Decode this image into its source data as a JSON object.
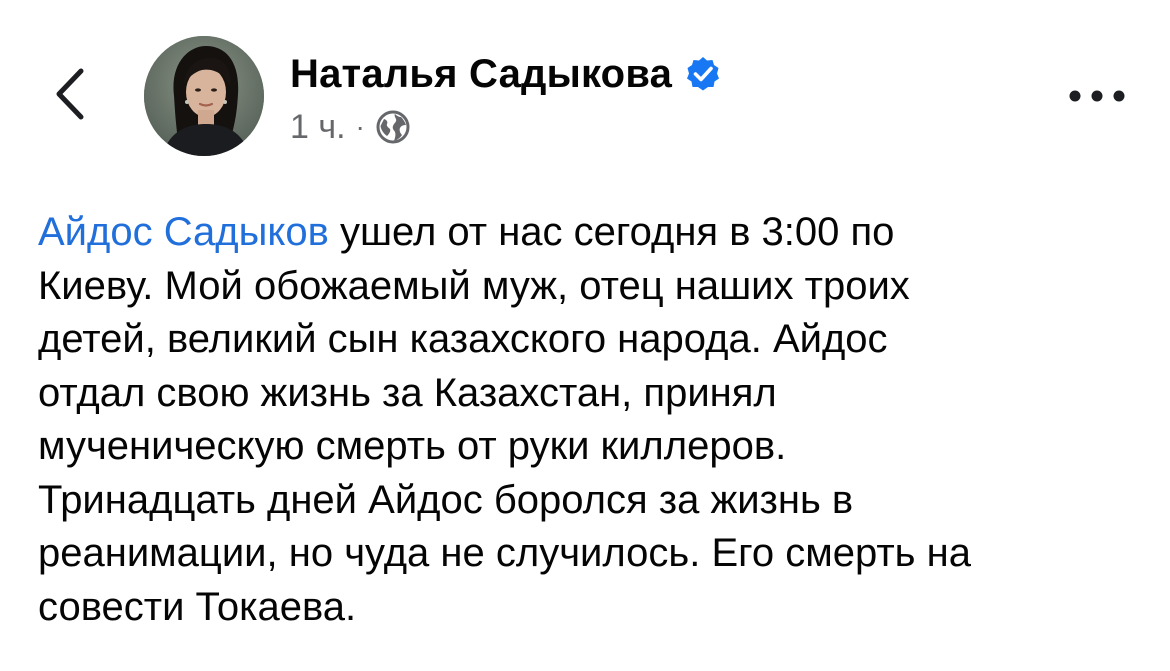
{
  "header": {
    "back_icon": "chevron-left-icon",
    "author_name": "Наталья Садыкова",
    "verified_icon": "verified-badge-icon",
    "verified_color": "#1877f2",
    "timestamp": "1 ч.",
    "separator": "·",
    "audience_icon": "globe-icon",
    "more_icon": "more-horizontal-icon"
  },
  "post": {
    "mention": "Айдос Садыков",
    "mention_color": "#216fdb",
    "line1_rest": " ушел от нас сегодня в 3:00 по",
    "line2": "Киеву. Мой обожаемый муж, отец наших троих",
    "line3": "детей, великий сын казахского народа. Айдос",
    "line4": "отдал свою жизнь за Казахстан, принял",
    "line5": "мученическую смерть от руки киллеров.",
    "line6": "Тринадцать дней Айдос боролся за жизнь в",
    "line7": "реанимации, но чуда не случилось. Его смерть на",
    "line8": "совести Токаева."
  }
}
